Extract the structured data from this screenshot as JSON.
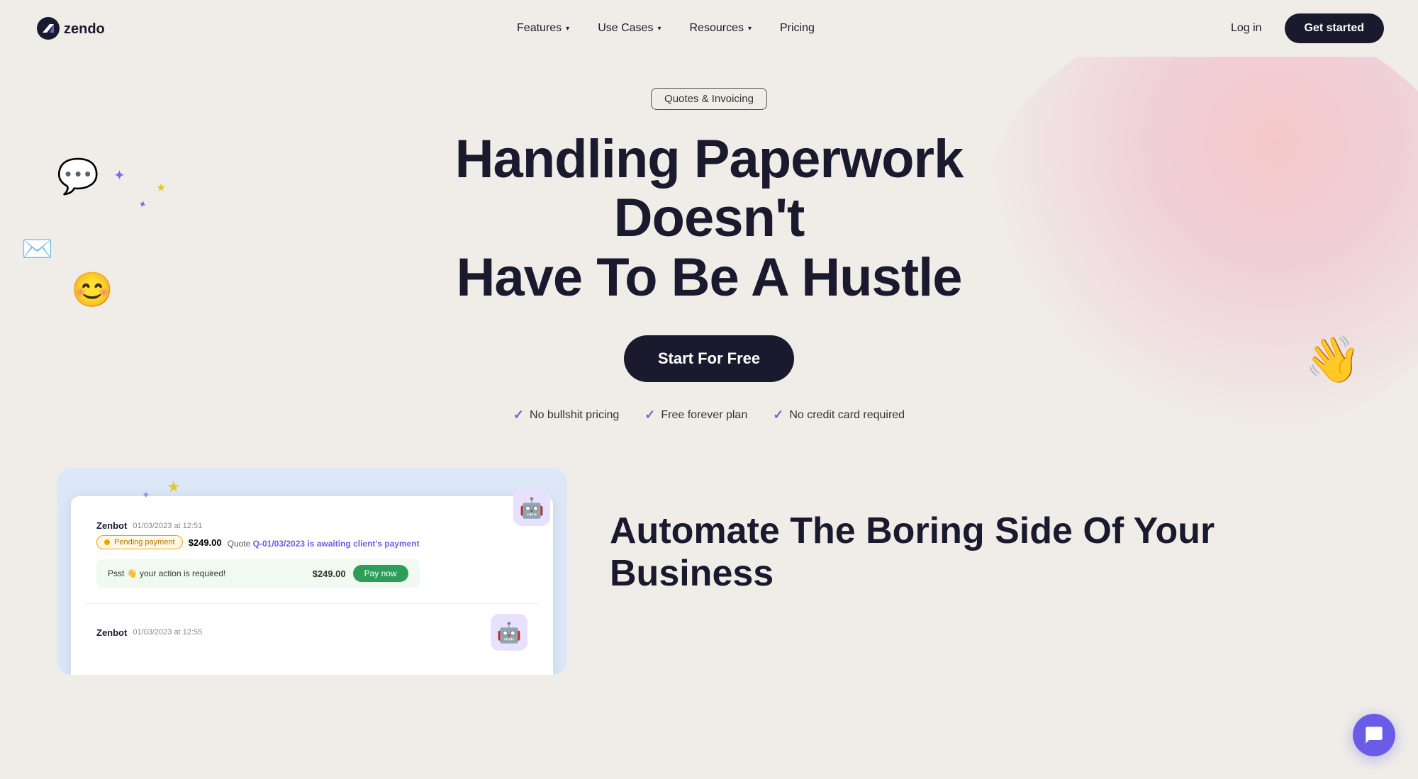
{
  "nav": {
    "logo_text": "zendo",
    "links": [
      {
        "label": "Features",
        "has_dropdown": true
      },
      {
        "label": "Use Cases",
        "has_dropdown": true
      },
      {
        "label": "Resources",
        "has_dropdown": true
      },
      {
        "label": "Pricing",
        "has_dropdown": false
      }
    ],
    "login_label": "Log in",
    "cta_label": "Get started"
  },
  "hero": {
    "badge": "Quotes & Invoicing",
    "title_line1": "Handling Paperwork Doesn't",
    "title_line2": "Have To Be A Hustle",
    "cta_label": "Start For Free",
    "features": [
      {
        "label": "No bullshit pricing"
      },
      {
        "label": "Free forever plan"
      },
      {
        "label": "No credit card required"
      }
    ]
  },
  "lower": {
    "title_line1": "Automate The Boring Side Of Your",
    "title_line2": "Business"
  },
  "app_card": {
    "rows": [
      {
        "sender": "Zenbot",
        "date": "01/03/2023 at 12:51",
        "badge": "Pending payment",
        "amount": "$249.00",
        "quote_ref": "Q-01/03/2023",
        "info": "is awaiting client's payment",
        "psst": "Psst 👋 your action is required!",
        "psst_amount": "$249.00",
        "pay_label": "Pay now"
      },
      {
        "sender": "Zenbot",
        "date": "01/03/2023 at 12:55"
      }
    ]
  },
  "icons": {
    "check": "✓",
    "chevron": "▾",
    "chat_bubble": "💬",
    "email": "✉",
    "emoji": "😊",
    "star_yellow": "★",
    "star_purple": "✦",
    "wave": "👋",
    "robot": "🤖"
  }
}
